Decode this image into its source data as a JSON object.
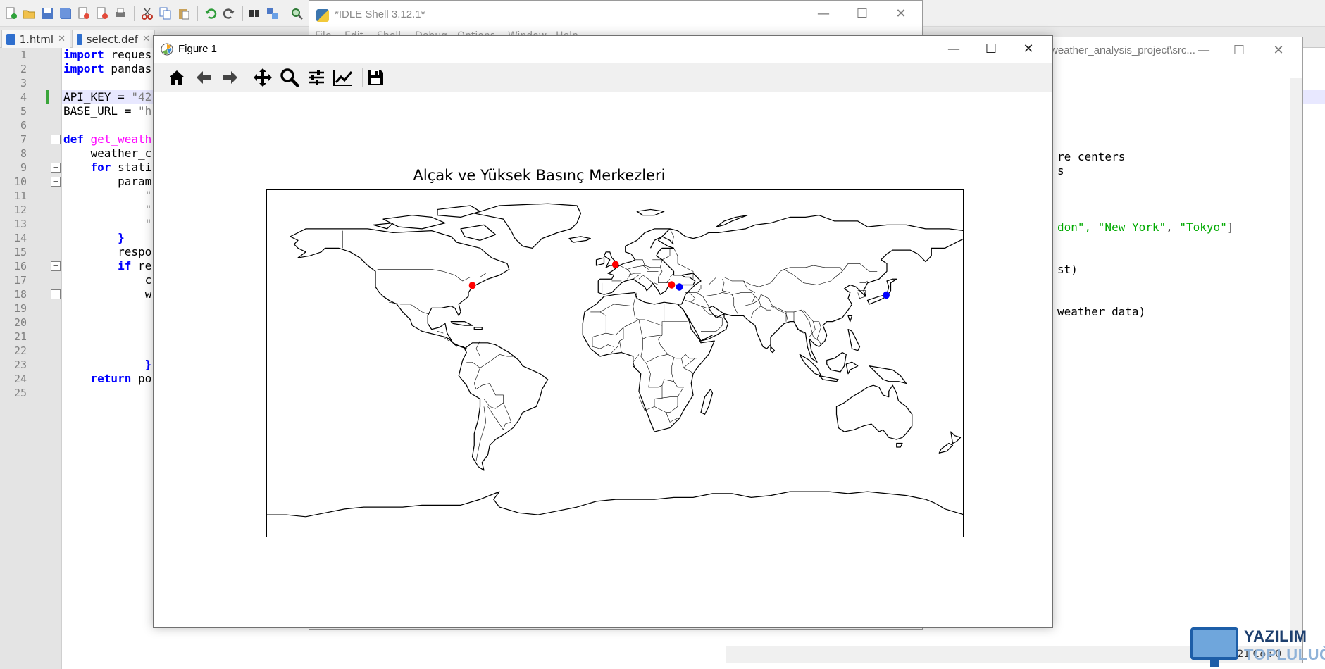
{
  "npp": {
    "tabs": [
      {
        "label": "1.html"
      },
      {
        "label": "select.def"
      }
    ],
    "line_numbers": [
      "1",
      "2",
      "3",
      "4",
      "5",
      "6",
      "7",
      "8",
      "9",
      "10",
      "11",
      "12",
      "13",
      "14",
      "15",
      "16",
      "17",
      "18",
      "19",
      "20",
      "21",
      "22",
      "23",
      "24",
      "25"
    ],
    "code": {
      "l1_kw": "import",
      "l1_rest": " reques",
      "l2_kw": "import",
      "l2_rest": " pandas",
      "l4": "API_KEY = ",
      "l4_str": "\"42",
      "l5": "BASE_URL = ",
      "l5_str": "\"h",
      "l7_kw": "def",
      "l7_fn": " get_weath",
      "l8": "    weather_c",
      "l9_kw": "    for",
      "l9_rest": " stati",
      "l10": "        param",
      "l11": "            \"",
      "l12": "            \"",
      "l13": "            \"",
      "l14": "        }",
      "l15": "        respo",
      "l16_kw": "        if",
      "l16_rest": " re",
      "l17": "            c",
      "l18": "            w",
      "l23": "            }",
      "l24_kw": "    return",
      "l24_rest": " po"
    }
  },
  "idle_editor": {
    "title": "weather_analysis_project\\src...",
    "lines": {
      "l1": "re_centers",
      "l2": "s",
      "l3a": "don\", ",
      "l3b": "\"New York\"",
      "l3c": ", ",
      "l3d": "\"Tokyo\"",
      "l3e": "]",
      "l4": "st)",
      "l5": "weather_data)"
    },
    "status": "Ln: 21   Col: 0"
  },
  "idle_shell": {
    "title": "*IDLE Shell 3.12.1*",
    "menu": [
      "File",
      "Edit",
      "Shell",
      "Debug",
      "Options",
      "Window",
      "Help"
    ]
  },
  "figure": {
    "window_title": "Figure 1",
    "toolbar": [
      "home-icon",
      "back-icon",
      "forward-icon",
      "pan-icon",
      "zoom-icon",
      "configure-subplots-icon",
      "edit-axis-icon",
      "save-icon"
    ]
  },
  "chart_data": {
    "type": "scatter",
    "title": "Alçak ve Yüksek Basınç Merkezleri",
    "xlabel": "",
    "ylabel": "",
    "xlim": [
      -180,
      180
    ],
    "ylim": [
      -90,
      90
    ],
    "projection": "PlateCarree world map with coastlines and country borders",
    "grid": false,
    "series": [
      {
        "color": "#ff0000",
        "points": [
          {
            "x": -0.1,
            "y": 51.5
          },
          {
            "x": -74.0,
            "y": 40.7
          },
          {
            "x": 28.9,
            "y": 41.0
          }
        ]
      },
      {
        "color": "#0000ff",
        "points": [
          {
            "x": 32.9,
            "y": 39.9
          },
          {
            "x": 139.7,
            "y": 35.7
          }
        ]
      }
    ]
  },
  "logo": {
    "line1": "YAZILIM",
    "line2": "TOPLULUĞU"
  }
}
